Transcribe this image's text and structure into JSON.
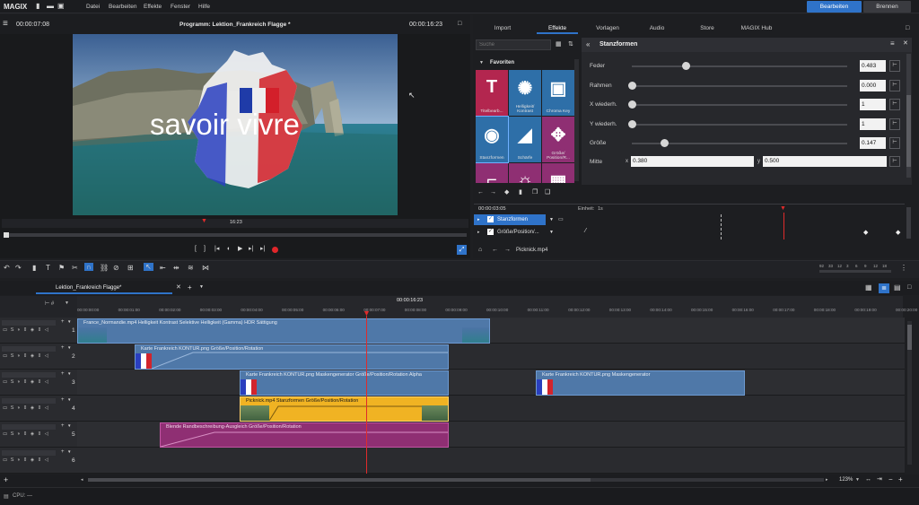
{
  "menubar": {
    "logo": "MAGIX",
    "items": [
      "Datei",
      "Bearbeiten",
      "Effekte",
      "Fenster",
      "Hilfe"
    ],
    "btn_edit": "Bearbeiten",
    "btn_burn": "Brennen"
  },
  "preview": {
    "time_left": "00:00:07:08",
    "title": "Programm: Lektion_Frankreich Flagge *",
    "time_right": "00:00:16:23",
    "overlay_text": "savoir vivre",
    "scrub_time": "16:23"
  },
  "tabs": [
    "Import",
    "Effekte",
    "Vorlagen",
    "Audio",
    "Store",
    "MAGIX Hub"
  ],
  "effects": {
    "search_placeholder": "Suche",
    "category": "Favoriten",
    "tiles": [
      {
        "label": "Titelbearb...",
        "color": "#b3264f",
        "icon": "T"
      },
      {
        "label": "Helligkeit/ Kontrast",
        "color": "#2e6fa8",
        "icon": "✺"
      },
      {
        "label": "Chroma Key",
        "color": "#2e6fa8",
        "icon": "▣"
      },
      {
        "label": "Stanzformen",
        "color": "#2e6fa8",
        "icon": "◉"
      },
      {
        "label": "Schärfe",
        "color": "#2e6fa8",
        "icon": "◢"
      },
      {
        "label": "Größe/ Position/R...",
        "color": "#8f2f73",
        "icon": "✥"
      },
      {
        "label": "",
        "color": "#8f2f73",
        "icon": "⌐"
      },
      {
        "label": "",
        "color": "#8f2f73",
        "icon": "☼"
      },
      {
        "label": "",
        "color": "#8f2f73",
        "icon": "▦"
      }
    ]
  },
  "params": {
    "title": "Stanzformen",
    "rows": [
      {
        "label": "Feder",
        "value": "0.483",
        "pos": 0.25
      },
      {
        "label": "Rahmen",
        "value": "0.000",
        "pos": 0.0
      },
      {
        "label": "X wiederh.",
        "value": "1",
        "pos": 0.0
      },
      {
        "label": "Y wiederh.",
        "value": "1",
        "pos": 0.0
      },
      {
        "label": "Größe",
        "value": "0.147",
        "pos": 0.15
      }
    ],
    "center_label": "Mitte",
    "x_label": "x",
    "x_value": "0.380",
    "y_label": "y",
    "y_value": "0.500"
  },
  "kf": {
    "time": "00:00:03:05",
    "unit_label": "Einheit:",
    "unit": "1s",
    "row1": "Stanzformen",
    "row2": "Größe/Position/...",
    "clip": "Picknick.mp4"
  },
  "timeline": {
    "tab": "Lektion_Frankreich Flagge*",
    "cursor_time": "00:00:16:23",
    "zoom": "123%",
    "cpu": "CPU: —",
    "ticks": [
      "00:00:00:00",
      "00:00:01:00",
      "00:00:02:00",
      "00:00:03:00",
      "00:00:04:00",
      "00:00:05:00",
      "00:00:06:00",
      "00:00:07:00",
      "00:00:08:00",
      "00:00:09:00",
      "00:00:10:00",
      "00:00:11:00",
      "00:00:12:00",
      "00:00:13:00",
      "00:00:14:00",
      "00:00:15:00",
      "00:00:16:00",
      "00:00:17:00",
      "00:00:18:00",
      "00:00:19:00",
      "00:00:20:00"
    ],
    "meter": [
      "92",
      "33",
      "12",
      "3",
      "6",
      "9",
      "12",
      "18"
    ],
    "tracks": [
      "1",
      "2",
      "3",
      "4",
      "5",
      "6"
    ],
    "clips": {
      "c1": "France_Normandie.mp4  Helligkeit  Kontrast  Selektive Helligkeit (Gamma)  HDR  Sättigung",
      "c2": "Karte Frankreich KONTUR.png  Größe/Position/Rotation",
      "c3": "Karte Frankreich KONTUR.png  Maskengenerator  Größe/Position/Rotation  Alpha",
      "c3b": "Karte Frankreich KONTUR.png  Maskengenerator",
      "c4": "Picknick.mp4  Stanzformen  Größe/Position/Rotation",
      "c5": "Blende  Randbeschreibung-Ausgleich  Größe/Position/Rotation"
    }
  }
}
